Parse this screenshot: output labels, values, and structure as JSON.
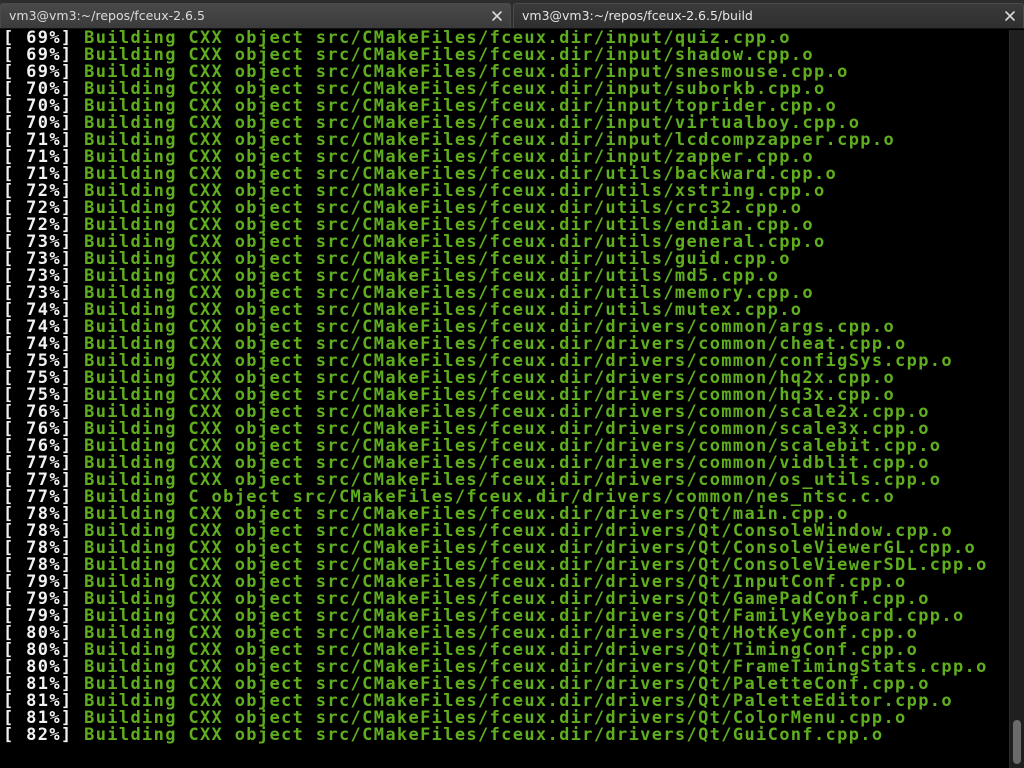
{
  "tabs": [
    {
      "title": "vm3@vm3:~/repos/fceux-2.6.5",
      "active": false,
      "close_icon": "close-icon"
    },
    {
      "title": "vm3@vm3:~/repos/fceux-2.6.5/build",
      "active": true,
      "close_icon": "close-icon"
    }
  ],
  "colors": {
    "background": "#000000",
    "percent_text": "#f2f2f2",
    "build_text": "#5fae1e",
    "tabbar": "#2d2d2d"
  },
  "scrollbar": {
    "position_fraction": 1.0,
    "visible_fraction": 0.06
  },
  "terminal": {
    "lines": [
      {
        "percent": "[ 69%]",
        "text": "Building CXX object src/CMakeFiles/fceux.dir/input/quiz.cpp.o"
      },
      {
        "percent": "[ 69%]",
        "text": "Building CXX object src/CMakeFiles/fceux.dir/input/shadow.cpp.o"
      },
      {
        "percent": "[ 69%]",
        "text": "Building CXX object src/CMakeFiles/fceux.dir/input/snesmouse.cpp.o"
      },
      {
        "percent": "[ 70%]",
        "text": "Building CXX object src/CMakeFiles/fceux.dir/input/suborkb.cpp.o"
      },
      {
        "percent": "[ 70%]",
        "text": "Building CXX object src/CMakeFiles/fceux.dir/input/toprider.cpp.o"
      },
      {
        "percent": "[ 70%]",
        "text": "Building CXX object src/CMakeFiles/fceux.dir/input/virtualboy.cpp.o"
      },
      {
        "percent": "[ 71%]",
        "text": "Building CXX object src/CMakeFiles/fceux.dir/input/lcdcompzapper.cpp.o"
      },
      {
        "percent": "[ 71%]",
        "text": "Building CXX object src/CMakeFiles/fceux.dir/input/zapper.cpp.o"
      },
      {
        "percent": "[ 71%]",
        "text": "Building CXX object src/CMakeFiles/fceux.dir/utils/backward.cpp.o"
      },
      {
        "percent": "[ 72%]",
        "text": "Building CXX object src/CMakeFiles/fceux.dir/utils/xstring.cpp.o"
      },
      {
        "percent": "[ 72%]",
        "text": "Building CXX object src/CMakeFiles/fceux.dir/utils/crc32.cpp.o"
      },
      {
        "percent": "[ 72%]",
        "text": "Building CXX object src/CMakeFiles/fceux.dir/utils/endian.cpp.o"
      },
      {
        "percent": "[ 73%]",
        "text": "Building CXX object src/CMakeFiles/fceux.dir/utils/general.cpp.o"
      },
      {
        "percent": "[ 73%]",
        "text": "Building CXX object src/CMakeFiles/fceux.dir/utils/guid.cpp.o"
      },
      {
        "percent": "[ 73%]",
        "text": "Building CXX object src/CMakeFiles/fceux.dir/utils/md5.cpp.o"
      },
      {
        "percent": "[ 73%]",
        "text": "Building CXX object src/CMakeFiles/fceux.dir/utils/memory.cpp.o"
      },
      {
        "percent": "[ 74%]",
        "text": "Building CXX object src/CMakeFiles/fceux.dir/utils/mutex.cpp.o"
      },
      {
        "percent": "[ 74%]",
        "text": "Building CXX object src/CMakeFiles/fceux.dir/drivers/common/args.cpp.o"
      },
      {
        "percent": "[ 74%]",
        "text": "Building CXX object src/CMakeFiles/fceux.dir/drivers/common/cheat.cpp.o"
      },
      {
        "percent": "[ 75%]",
        "text": "Building CXX object src/CMakeFiles/fceux.dir/drivers/common/configSys.cpp.o"
      },
      {
        "percent": "[ 75%]",
        "text": "Building CXX object src/CMakeFiles/fceux.dir/drivers/common/hq2x.cpp.o"
      },
      {
        "percent": "[ 75%]",
        "text": "Building CXX object src/CMakeFiles/fceux.dir/drivers/common/hq3x.cpp.o"
      },
      {
        "percent": "[ 76%]",
        "text": "Building CXX object src/CMakeFiles/fceux.dir/drivers/common/scale2x.cpp.o"
      },
      {
        "percent": "[ 76%]",
        "text": "Building CXX object src/CMakeFiles/fceux.dir/drivers/common/scale3x.cpp.o"
      },
      {
        "percent": "[ 76%]",
        "text": "Building CXX object src/CMakeFiles/fceux.dir/drivers/common/scalebit.cpp.o"
      },
      {
        "percent": "[ 77%]",
        "text": "Building CXX object src/CMakeFiles/fceux.dir/drivers/common/vidblit.cpp.o"
      },
      {
        "percent": "[ 77%]",
        "text": "Building CXX object src/CMakeFiles/fceux.dir/drivers/common/os_utils.cpp.o"
      },
      {
        "percent": "[ 77%]",
        "text": "Building C object src/CMakeFiles/fceux.dir/drivers/common/nes_ntsc.c.o"
      },
      {
        "percent": "[ 78%]",
        "text": "Building CXX object src/CMakeFiles/fceux.dir/drivers/Qt/main.cpp.o"
      },
      {
        "percent": "[ 78%]",
        "text": "Building CXX object src/CMakeFiles/fceux.dir/drivers/Qt/ConsoleWindow.cpp.o"
      },
      {
        "percent": "[ 78%]",
        "text": "Building CXX object src/CMakeFiles/fceux.dir/drivers/Qt/ConsoleViewerGL.cpp.o"
      },
      {
        "percent": "[ 78%]",
        "text": "Building CXX object src/CMakeFiles/fceux.dir/drivers/Qt/ConsoleViewerSDL.cpp.o"
      },
      {
        "percent": "[ 79%]",
        "text": "Building CXX object src/CMakeFiles/fceux.dir/drivers/Qt/InputConf.cpp.o"
      },
      {
        "percent": "[ 79%]",
        "text": "Building CXX object src/CMakeFiles/fceux.dir/drivers/Qt/GamePadConf.cpp.o"
      },
      {
        "percent": "[ 79%]",
        "text": "Building CXX object src/CMakeFiles/fceux.dir/drivers/Qt/FamilyKeyboard.cpp.o"
      },
      {
        "percent": "[ 80%]",
        "text": "Building CXX object src/CMakeFiles/fceux.dir/drivers/Qt/HotKeyConf.cpp.o"
      },
      {
        "percent": "[ 80%]",
        "text": "Building CXX object src/CMakeFiles/fceux.dir/drivers/Qt/TimingConf.cpp.o"
      },
      {
        "percent": "[ 80%]",
        "text": "Building CXX object src/CMakeFiles/fceux.dir/drivers/Qt/FrameTimingStats.cpp.o"
      },
      {
        "percent": "[ 81%]",
        "text": "Building CXX object src/CMakeFiles/fceux.dir/drivers/Qt/PaletteConf.cpp.o"
      },
      {
        "percent": "[ 81%]",
        "text": "Building CXX object src/CMakeFiles/fceux.dir/drivers/Qt/PaletteEditor.cpp.o"
      },
      {
        "percent": "[ 81%]",
        "text": "Building CXX object src/CMakeFiles/fceux.dir/drivers/Qt/ColorMenu.cpp.o"
      },
      {
        "percent": "[ 82%]",
        "text": "Building CXX object src/CMakeFiles/fceux.dir/drivers/Qt/GuiConf.cpp.o"
      }
    ]
  }
}
